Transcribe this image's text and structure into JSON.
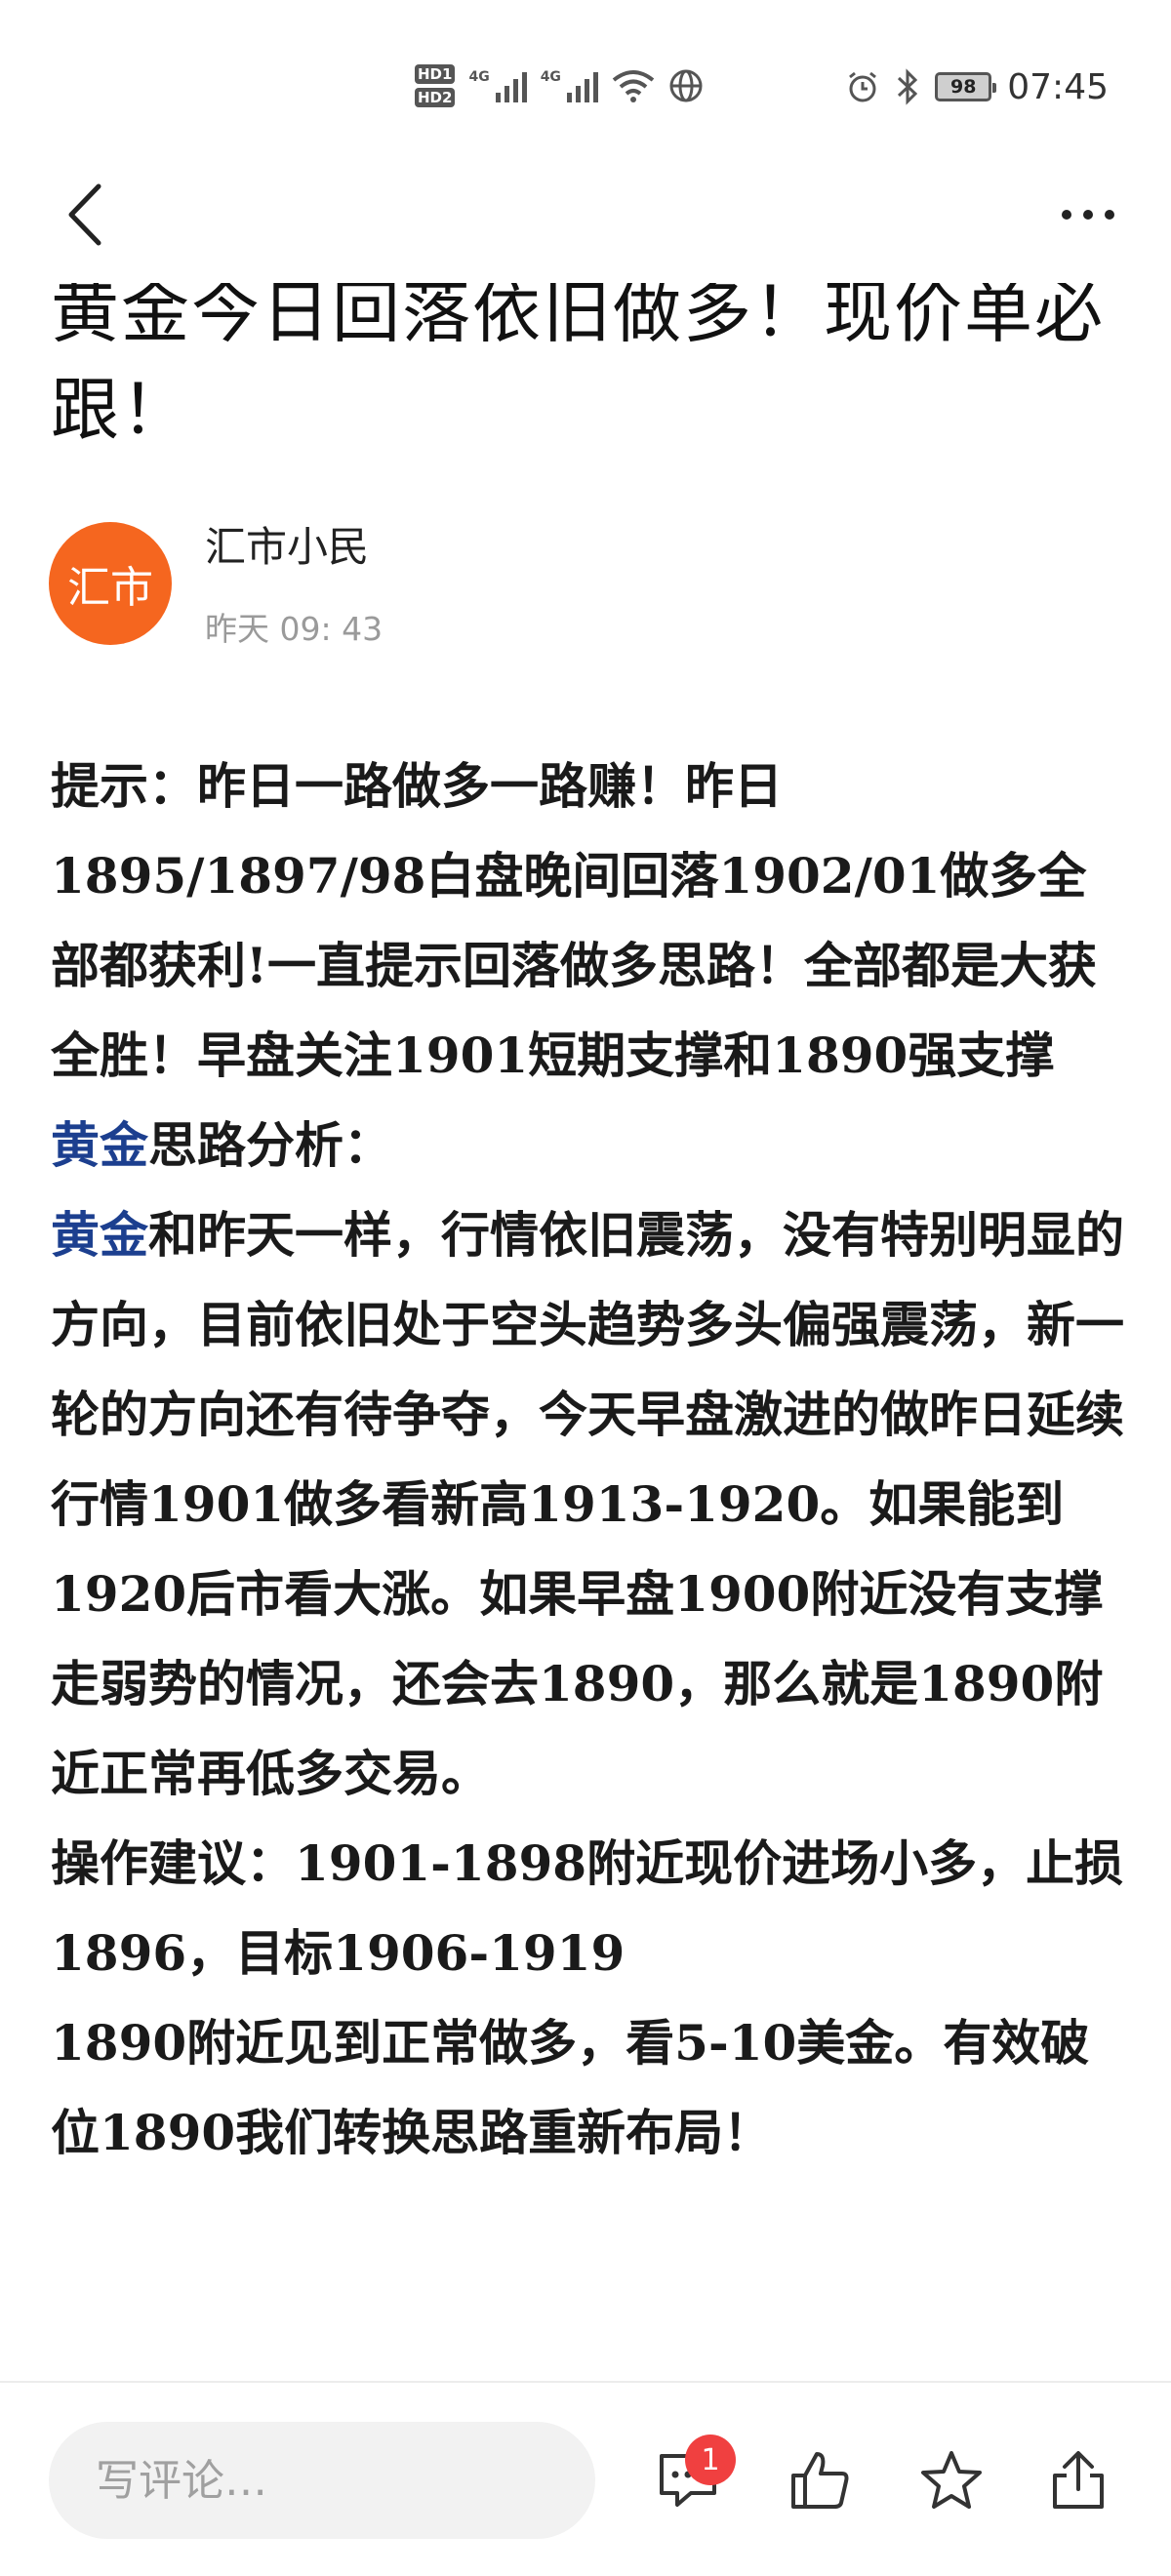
{
  "status_bar": {
    "hd1": "HD1",
    "hd2": "HD2",
    "network1": "4G",
    "network2": "4G",
    "battery": "98",
    "time": "07:45",
    "icons": [
      "alarm-icon",
      "bluetooth-icon",
      "wifi-icon",
      "globe-icon"
    ]
  },
  "header": {
    "back_icon": "chevron-left-icon",
    "more_icon": "more-dots-icon"
  },
  "article": {
    "title": "黄金今日回落依旧做多！现价单必跟！",
    "author": {
      "avatar_text": "汇市",
      "avatar_color": "#f5661f",
      "name": "汇市小民",
      "time": "昨天 09: 43"
    },
    "keyword_color": "#1c3f8f",
    "p1": "提示：昨日一路做多一路赚！昨日1895/1897/98白盘晚间回落1902/01做多全部都获利!一直提示回落做多思路！全部都是大获全胜！早盘关注1901短期支撑和1890强支撑",
    "p2_keyword": "黄金",
    "p2_rest": "思路分析：",
    "p3_keyword": "黄金",
    "p3_rest": "和昨天一样，行情依旧震荡，没有特别明显的方向，目前依旧处于空头趋势多头偏强震荡，新一轮的方向还有待争夺，今天早盘激进的做昨日延续行情1901做多看新高1913-1920。如果能到1920后市看大涨。如果早盘1900附近没有支撑走弱势的情况，还会去1890，那么就是1890附近正常再低多交易。",
    "p4": "操作建议：1901-1898附近现价进场小多，止损1896，目标1906-1919",
    "p5": "1890附近见到正常做多，看5-10美金。有效破位1890我们转换思路重新布局！"
  },
  "bottom_bar": {
    "comment_placeholder": "写评论…",
    "comment_badge": "1",
    "icons": [
      "comment-icon",
      "like-icon",
      "favorite-star-icon",
      "share-icon"
    ]
  }
}
